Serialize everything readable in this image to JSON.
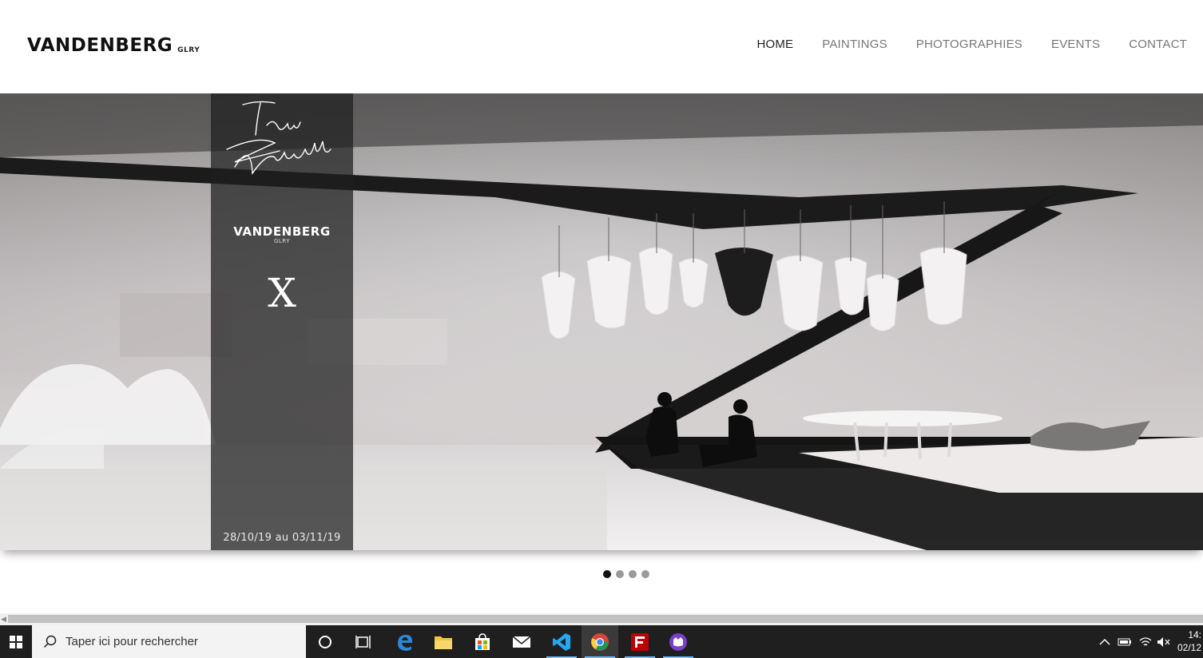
{
  "header": {
    "logo_main": "VANDENBERG",
    "logo_sub": "GLRY",
    "nav": [
      {
        "label": "HOME",
        "active": true
      },
      {
        "label": "PAINTINGS",
        "active": false
      },
      {
        "label": "PHOTOGRAPHIES",
        "active": false
      },
      {
        "label": "EVENTS",
        "active": false
      },
      {
        "label": "CONTACT",
        "active": false
      }
    ]
  },
  "hero": {
    "panel_brand": "VANDENBERG",
    "panel_brand_sub": "GLRY",
    "panel_x": "X",
    "signature_line1": "Tsuyu",
    "signature_line2": "Bridwell",
    "date": "28/10/19  au  03/11/19",
    "slide_count": 4,
    "active_slide": 1
  },
  "taskbar": {
    "search_placeholder": "Taper ici pour rechercher",
    "apps": [
      "cortana-icon",
      "task-view-icon",
      "edge-icon",
      "file-explorer-icon",
      "store-icon",
      "mail-icon",
      "vscode-icon",
      "chrome-icon",
      "filezilla-icon",
      "app-purple-icon"
    ],
    "clock_time": "14:",
    "clock_date": "02/12"
  },
  "colors": {
    "accent": "#111111",
    "nav_inactive": "#777777",
    "taskbar": "#1f1f1f",
    "panel_overlay": "rgba(30,30,30,0.72)"
  }
}
